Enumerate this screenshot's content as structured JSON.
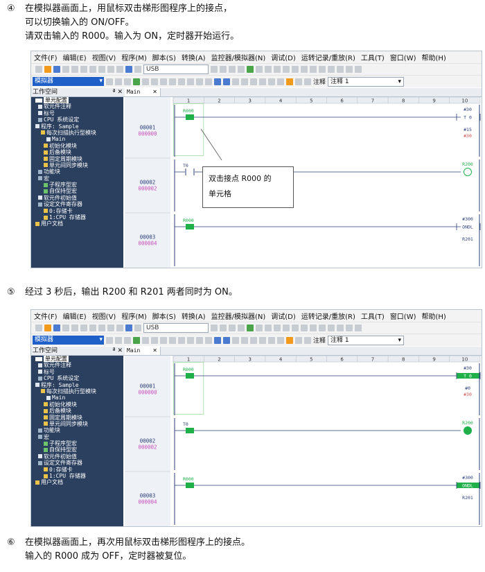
{
  "steps": [
    {
      "number": "④",
      "lines": [
        "在模拟器画面上，用鼠标双击梯形图程序上的接点，",
        "可以切换输入的 ON/OFF。",
        "请双击输入的 R000。输入为 ON，定时器开始运行。"
      ]
    },
    {
      "number": "⑤",
      "lines": [
        "经过 3 秒后，输出 R200 和 R201 两者同时为 ON。"
      ]
    },
    {
      "number": "⑥",
      "lines": [
        "在模拟器画面上，再次用鼠标双击梯形图程序上的接点。",
        "输入的 R000 成为 OFF，定时器被复位。"
      ]
    }
  ],
  "menu": [
    "文件(F)",
    "编辑(E)",
    "视图(V)",
    "程序(M)",
    "脚本(S)",
    "转换(A)",
    "监控器/模拟器(N)",
    "调试(D)",
    "运转记录/重放(R)",
    "工具(T)",
    "窗口(W)",
    "帮助(H)"
  ],
  "toolbar": {
    "usb_combo": "USB",
    "simulator_combo": "模拟器",
    "comment_label": "注释",
    "comment_combo": "注释 1"
  },
  "workspace": {
    "title": "工作空间",
    "controls": "ª ✕",
    "tree": [
      {
        "label": "单元配置",
        "selected": true
      },
      {
        "label": "软元件注释"
      },
      {
        "label": "标号"
      },
      {
        "label": "CPU 系统设定"
      },
      {
        "label": "程序: Sample"
      },
      {
        "label": "每次扫描执行型模块"
      },
      {
        "label": "Main"
      },
      {
        "label": "初始化模块"
      },
      {
        "label": "后备模块"
      },
      {
        "label": "固定周期模块"
      },
      {
        "label": "单元间同步模块"
      },
      {
        "label": "功能块"
      },
      {
        "label": "宏"
      },
      {
        "label": "子程序型宏"
      },
      {
        "label": "自保持型宏"
      },
      {
        "label": "软元件初始值"
      },
      {
        "label": "设定文件寄存器"
      },
      {
        "label": "0:存储卡"
      },
      {
        "label": "1:CPU 存储器"
      },
      {
        "label": "用户文档"
      }
    ]
  },
  "editor_tab": {
    "label": "Main",
    "close": "✕"
  },
  "ladder": {
    "columns": [
      "1",
      "2",
      "3",
      "4",
      "5",
      "6",
      "7",
      "8",
      "9",
      "10"
    ],
    "rungs": [
      {
        "line": "00001",
        "step": "000000",
        "contact": "R000",
        "coil_top": "#30",
        "coil_mid": "T 0",
        "coil_bot1": "#15",
        "coil_bot2": "#30"
      },
      {
        "line": "00002",
        "step": "000002",
        "contact": "T0",
        "coil_top": "R200"
      },
      {
        "line": "00003",
        "step": "000004",
        "contact": "R000",
        "coil_top": "#300",
        "coil_mid": "ONDL",
        "coil_bot1": "R201"
      }
    ],
    "rungs_after": [
      {
        "coil_bot1": "#0",
        "coil_bot2": "#30"
      }
    ]
  },
  "callout": {
    "lines": [
      "双击接点 R000 的",
      "单元格"
    ]
  },
  "colors": {
    "tree_bg": "#2b3f5e",
    "green": "#1fb04a",
    "step_magenta": "#c84fbd",
    "line_navy": "#2a3c78"
  }
}
